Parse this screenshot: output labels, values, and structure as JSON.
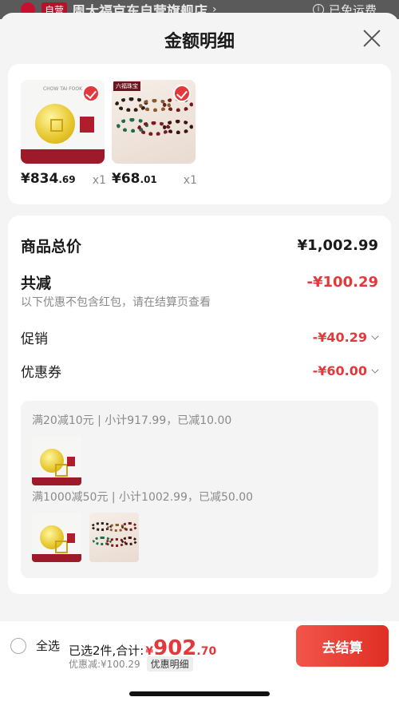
{
  "background_store": {
    "tag": "自营",
    "name": "周大福京东自营旗舰店",
    "chevron": "›",
    "shipping": "已免运费",
    "info_icon": "info-icon"
  },
  "sheet": {
    "title": "金额明细"
  },
  "products": [
    {
      "name": "gold-coin-pendant",
      "price_yen": "¥",
      "price_int": "834",
      "price_dec": ".69",
      "qty": "x1",
      "selected": true
    },
    {
      "name": "bracelet-set",
      "price_yen": "¥",
      "price_int": "68",
      "price_dec": ".01",
      "qty": "x1",
      "selected": true
    }
  ],
  "summary": {
    "total_label": "商品总价",
    "total_value": "¥1,002.99",
    "reduce_label": "共减",
    "reduce_value": "-¥100.29",
    "note": "以下优惠不包含红包，请在结算页查看",
    "promo_label": "促销",
    "promo_value": "-¥40.29",
    "coupon_label": "优惠券",
    "coupon_value": "-¥60.00"
  },
  "detail": {
    "line1": "满20减10元 | 小计917.99，已减10.00",
    "line2": "满1000减50元 | 小计1002.99，已减50.00"
  },
  "bottom": {
    "select_all": "全选",
    "selected": "已选2件,合计:",
    "total_yen": "¥",
    "total_int": "902",
    "total_dec": ".70",
    "discount": "优惠减:¥100.29",
    "detail_tag": "优惠明细",
    "checkout": "去结算"
  },
  "images": {
    "gold_brand": "CHOW TAI FOOK",
    "bracelet_label": "六福珠宝"
  },
  "colors": {
    "accent_red": "#e4393c",
    "checkout_gradient": [
      "#f2554b",
      "#e02e24"
    ]
  }
}
